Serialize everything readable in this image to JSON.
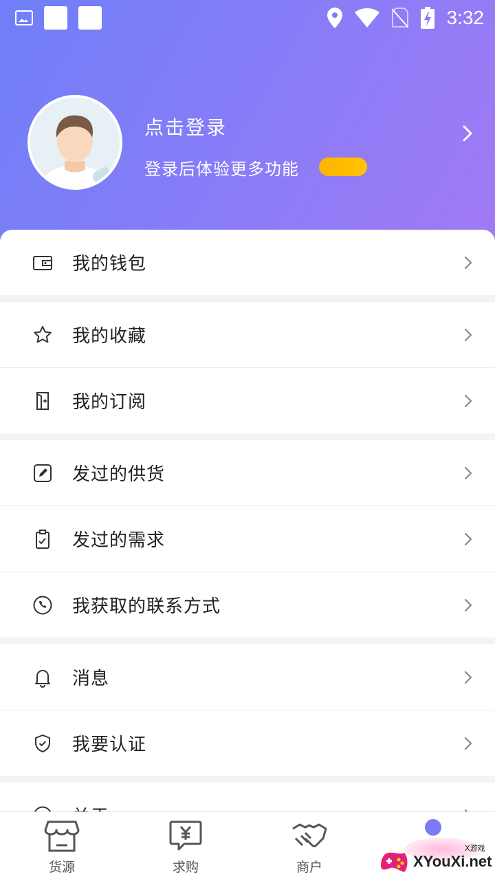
{
  "status_bar": {
    "time": "3:32"
  },
  "profile": {
    "login_title": "点击登录",
    "login_subtitle": "登录后体验更多功能"
  },
  "menu": {
    "groups": [
      [
        {
          "label": "我的钱包",
          "icon": "wallet-icon"
        }
      ],
      [
        {
          "label": "我的收藏",
          "icon": "star-icon"
        },
        {
          "label": "我的订阅",
          "icon": "subscribe-icon"
        }
      ],
      [
        {
          "label": "发过的供货",
          "icon": "edit-icon"
        },
        {
          "label": "发过的需求",
          "icon": "clipboard-check-icon"
        },
        {
          "label": "我获取的联系方式",
          "icon": "phone-icon"
        }
      ],
      [
        {
          "label": "消息",
          "icon": "bell-icon"
        },
        {
          "label": "我要认证",
          "icon": "shield-check-icon"
        }
      ],
      [
        {
          "label": "关于",
          "icon": "info-icon"
        }
      ]
    ]
  },
  "bottom_nav": {
    "tabs": [
      {
        "label": "货源",
        "icon": "store-icon"
      },
      {
        "label": "求购",
        "icon": "yuan-chat-icon"
      },
      {
        "label": "商户",
        "icon": "handshake-icon"
      },
      {
        "label": "",
        "icon": "profile-icon"
      }
    ]
  },
  "watermark": {
    "text": "XYouXi.net",
    "small": "X游戏"
  },
  "colors": {
    "accent": "#7b7cf2",
    "badge": "#ffb300",
    "gradient_start": "#6f7ff7",
    "gradient_end": "#a27af5"
  }
}
